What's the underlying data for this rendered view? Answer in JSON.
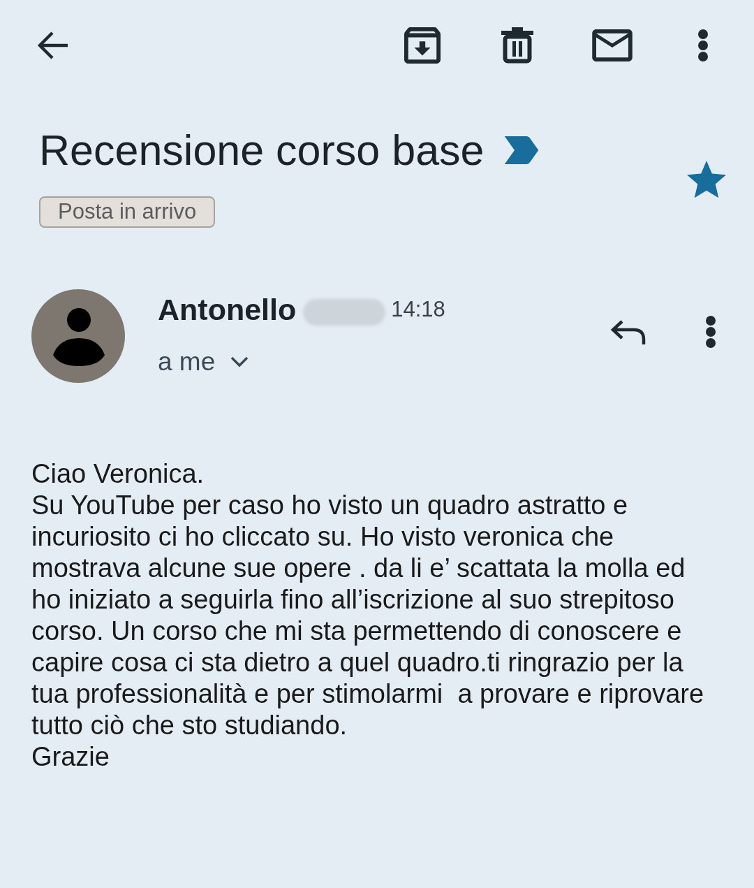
{
  "subject": {
    "title": "Recensione corso base",
    "important": true,
    "starred": true,
    "labels": [
      "Posta in arrivo"
    ]
  },
  "message": {
    "sender": "Antonello",
    "surname_hidden": true,
    "time": "14:18",
    "recipient": "a me",
    "body": [
      "Ciao Veronica.",
      "Su YouTube per caso ho visto un quadro astratto e incuriosito ci ho cliccato su. Ho visto veronica che mostrava alcune sue opere . da li e’ scattata la molla ed ho iniziato a seguirla fino all’iscrizione al suo strepitoso corso. Un corso che mi sta permettendo di conoscere e capire cosa ci sta dietro a quel quadro.ti ringrazio per la tua professionalità e per stimolarmi  a provare e riprovare tutto ciò che sto studiando.",
      "Grazie"
    ]
  }
}
